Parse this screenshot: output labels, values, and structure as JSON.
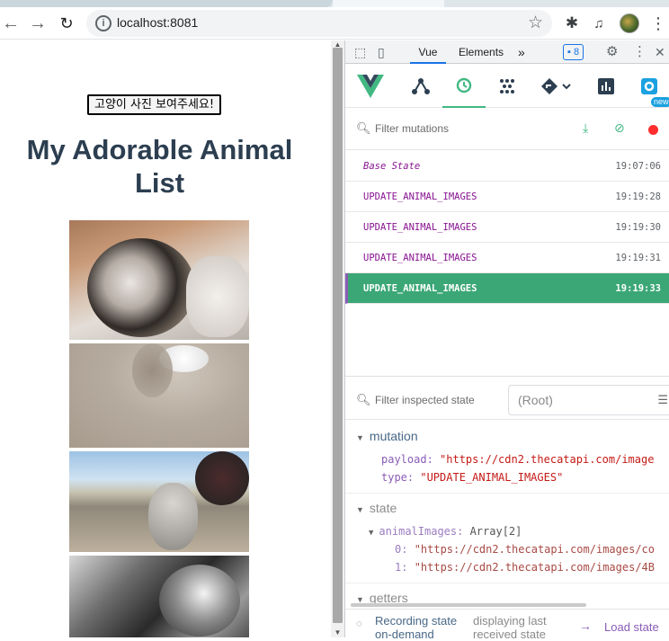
{
  "browser": {
    "url": "localhost:8081",
    "icons": {
      "back": "arrow-left-icon",
      "forward": "arrow-right-icon",
      "reload": "reload-icon",
      "info": "info-icon",
      "star": "star-icon",
      "extensions": "puzzle-icon",
      "media": "playlist-icon",
      "menu": "kebab-menu-icon"
    }
  },
  "app": {
    "button_label": "고양이 사진 보여주세요!",
    "title": "My Adorable Animal List",
    "images": [
      "cat-image-1",
      "cat-image-2",
      "cat-image-3",
      "cat-image-4"
    ]
  },
  "devtools": {
    "tabs": [
      {
        "label": "Vue",
        "active": true
      },
      {
        "label": "Elements",
        "active": false
      }
    ],
    "more_tabs": "»",
    "issues_count": "8",
    "vue_tools": [
      "components-icon",
      "timeline-icon",
      "vuex-icon",
      "router-icon",
      "performance-icon",
      "settings-icon"
    ],
    "settings_badge": "new",
    "mutation_filter_placeholder": "Filter mutations",
    "mutations": [
      {
        "name": "Base State",
        "time": "19:07:06",
        "base": true,
        "selected": false
      },
      {
        "name": "UPDATE_ANIMAL_IMAGES",
        "time": "19:19:28",
        "base": false,
        "selected": false
      },
      {
        "name": "UPDATE_ANIMAL_IMAGES",
        "time": "19:19:30",
        "base": false,
        "selected": false
      },
      {
        "name": "UPDATE_ANIMAL_IMAGES",
        "time": "19:19:31",
        "base": false,
        "selected": false
      },
      {
        "name": "UPDATE_ANIMAL_IMAGES",
        "time": "19:19:33",
        "base": false,
        "selected": true
      }
    ],
    "state_filter_placeholder": "Filter inspected state",
    "root_selector": "(Root)",
    "inspector": {
      "mutation_header": "mutation",
      "payload_key": "payload:",
      "payload_value": "\"https://cdn2.thecatapi.com/image",
      "type_key": "type:",
      "type_value": "\"UPDATE_ANIMAL_IMAGES\"",
      "state_header": "state",
      "animal_images_key": "animalImages:",
      "animal_images_type": "Array[2]",
      "item0_index": "0:",
      "item0_value": "\"https://cdn2.thecatapi.com/images/co",
      "item1_index": "1:",
      "item1_value": "\"https://cdn2.thecatapi.com/images/4B",
      "getters_header": "getters"
    },
    "bottom": {
      "recording": "Recording state on-demand",
      "displaying": "displaying last received state",
      "load": "Load state"
    }
  },
  "colors": {
    "vue_green": "#42b883",
    "selected_row": "#3ba776",
    "title": "#2c3e50",
    "purple": "#8a5db6",
    "string_red": "#c41a16"
  }
}
